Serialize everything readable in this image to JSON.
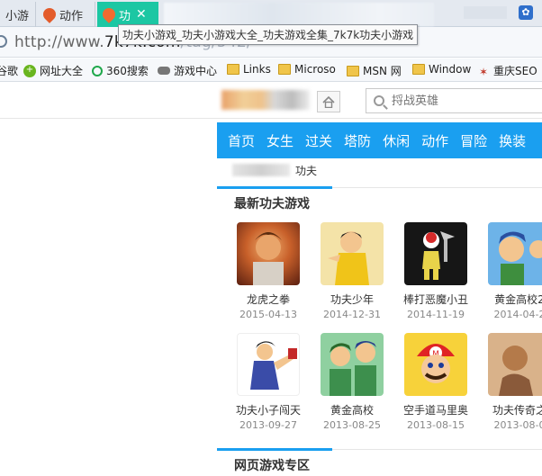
{
  "tabs": [
    {
      "label": "小游",
      "icon": "globe-icon"
    },
    {
      "label": "动作",
      "icon": "balloon-icon"
    },
    {
      "label": "功",
      "icon": "balloon-icon",
      "close": "✕"
    }
  ],
  "address": {
    "url_prefix": "http://www.",
    "url_domain": "7k7k.com",
    "url_tail": "/tag/542/"
  },
  "tooltip": "功夫小游戏_功夫小游戏大全_功夫游戏全集_7k7k功夫小游戏",
  "bookmarks": [
    {
      "label": "谷歌",
      "icon": "google-icon"
    },
    {
      "label": "网址大全",
      "icon": "green-plus-icon"
    },
    {
      "label": "360搜索",
      "icon": "360-ring-icon"
    },
    {
      "label": "游戏中心",
      "icon": "gamepad-icon"
    },
    {
      "label": "Links",
      "icon": "folder-icon"
    },
    {
      "label": "Microso",
      "icon": "folder-icon"
    },
    {
      "label": "MSN 网",
      "icon": "folder-icon"
    },
    {
      "label": "Window",
      "icon": "folder-icon"
    },
    {
      "label": "重庆SEO",
      "icon": "chongqing-icon"
    }
  ],
  "search": {
    "placeholder": "捋战英雄"
  },
  "nav": [
    "首页",
    "女生",
    "过关",
    "塔防",
    "休闲",
    "动作",
    "冒险",
    "换装"
  ],
  "breadcrumb": {
    "current": "功夫"
  },
  "sections": {
    "latest_title": "最新功夫游戏",
    "webgame_title": "网页游戏专区"
  },
  "games": [
    {
      "name": "龙虎之拳",
      "date": "2015-04-13"
    },
    {
      "name": "功夫少年",
      "date": "2014-12-31"
    },
    {
      "name": "棒打恶魔小丑",
      "date": "2014-11-19"
    },
    {
      "name": "黄金高校2",
      "date": "2014-04-2"
    },
    {
      "name": "功夫小子闯天",
      "date": "2013-09-27"
    },
    {
      "name": "黄金高校",
      "date": "2013-08-25"
    },
    {
      "name": "空手道马里奥",
      "date": "2013-08-15"
    },
    {
      "name": "功夫传奇之",
      "date": "2013-08-0"
    }
  ],
  "colors": {
    "accent": "#1a9ff0",
    "active_tab": "#1cc7a3"
  }
}
